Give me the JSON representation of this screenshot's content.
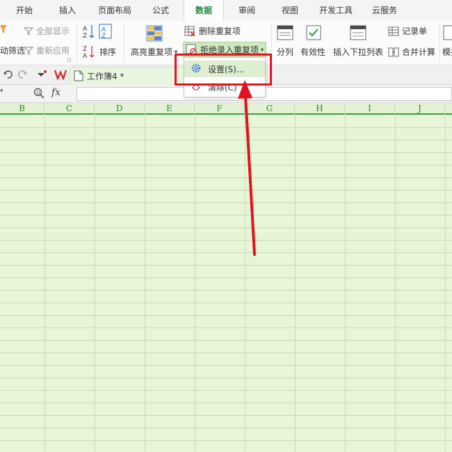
{
  "tabs": [
    {
      "label": "开始"
    },
    {
      "label": "插入"
    },
    {
      "label": "页面布局"
    },
    {
      "label": "公式"
    },
    {
      "label": "数据",
      "active": true
    },
    {
      "label": "审阅"
    },
    {
      "label": "视图"
    },
    {
      "label": "开发工具"
    },
    {
      "label": "云服务"
    }
  ],
  "ribbon": {
    "show_all": "全部显示",
    "reapply": "重新应用",
    "filter_partial": "动筛选",
    "sort": "排序",
    "highlight_dup": "高亮重复项",
    "remove_dup": "删除重复项",
    "reject_dup": "拒绝录入重复项",
    "split": "分列",
    "validity": "有效性",
    "insert_dropdown": "插入下拉列表",
    "record_form": "记录单",
    "consolidate": "合并计算",
    "simulate_partial": "模拟"
  },
  "doc_tab": {
    "title": "工作簿4 *"
  },
  "formula_bar": {
    "fx_label": "fx",
    "value": ""
  },
  "columns": [
    "B",
    "C",
    "D",
    "E",
    "F",
    "G",
    "H",
    "I",
    "J"
  ],
  "dropdown": {
    "settings": "设置(S)...",
    "clear": "清除(C)"
  },
  "colors": {
    "accent": "#1e8a3c",
    "highlight_border": "#e3121c",
    "arrow": "#e3121c",
    "grid_bg": "#e6f6d6"
  }
}
